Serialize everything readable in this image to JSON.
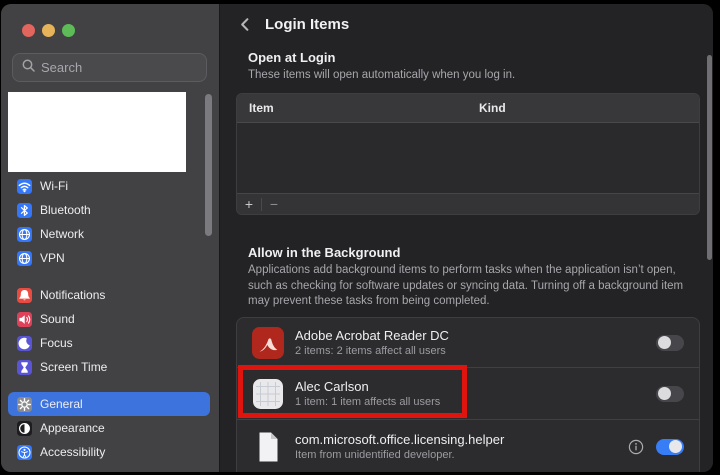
{
  "colors": {
    "accent_blue": "#3d73dd",
    "toggle_on": "#377df6",
    "annotation_red": "#e0140e",
    "traffic_red": "#e2655e",
    "traffic_yellow": "#e6b35a",
    "traffic_green": "#5dbc57"
  },
  "sidebar": {
    "search_placeholder": "Search",
    "items": [
      {
        "label": "Wi-Fi",
        "icon": "wifi",
        "bg": "#3577f6",
        "gap": false,
        "selected": false
      },
      {
        "label": "Bluetooth",
        "icon": "bluetooth",
        "bg": "#3577f6",
        "gap": false,
        "selected": false
      },
      {
        "label": "Network",
        "icon": "network-globe",
        "bg": "#3577f6",
        "gap": false,
        "selected": false
      },
      {
        "label": "VPN",
        "icon": "vpn-globe",
        "bg": "#3577f6",
        "gap": false,
        "selected": false
      },
      {
        "label": "Notifications",
        "icon": "notifications-bell",
        "bg": "#eb4a40",
        "gap": true,
        "selected": false
      },
      {
        "label": "Sound",
        "icon": "sound-speaker",
        "bg": "#e0415a",
        "gap": false,
        "selected": false
      },
      {
        "label": "Focus",
        "icon": "focus-moon",
        "bg": "#5a55d6",
        "gap": false,
        "selected": false
      },
      {
        "label": "Screen Time",
        "icon": "screen-time-hourglass",
        "bg": "#5a55d6",
        "gap": false,
        "selected": false
      },
      {
        "label": "General",
        "icon": "general-gear",
        "bg": "#8a8a8f",
        "gap": true,
        "selected": true
      },
      {
        "label": "Appearance",
        "icon": "appearance-contrast",
        "bg": "#1d1d1f",
        "gap": false,
        "selected": false
      },
      {
        "label": "Accessibility",
        "icon": "accessibility-figure",
        "bg": "#3577f6",
        "gap": false,
        "selected": false
      }
    ]
  },
  "header": {
    "title": "Login Items"
  },
  "open_at_login": {
    "heading": "Open at Login",
    "description": "These items will open automatically when you log in.",
    "table": {
      "columns": [
        "Item",
        "Kind"
      ],
      "rows": [],
      "add_label": "+",
      "remove_label": "−"
    }
  },
  "allow_in_background": {
    "heading": "Allow in the Background",
    "description": "Applications add background items to perform tasks when the application isn’t open, such as checking for software updates or syncing data. Turning off a background item may prevent these tasks from being completed.",
    "items": [
      {
        "name": "Adobe Acrobat Reader DC",
        "detail": "2 items: 2 items affect all users",
        "icon": "adobe-acrobat",
        "toggle": false,
        "info": false,
        "annotated": false
      },
      {
        "name": "Alec Carlson",
        "detail": "1 item: 1 item affects all users",
        "icon": "generic-app-grid",
        "toggle": false,
        "info": false,
        "annotated": true
      },
      {
        "name": "com.microsoft.office.licensing.helper",
        "detail": "Item from unidentified developer.",
        "icon": "document",
        "toggle": true,
        "info": true,
        "annotated": false
      }
    ]
  }
}
